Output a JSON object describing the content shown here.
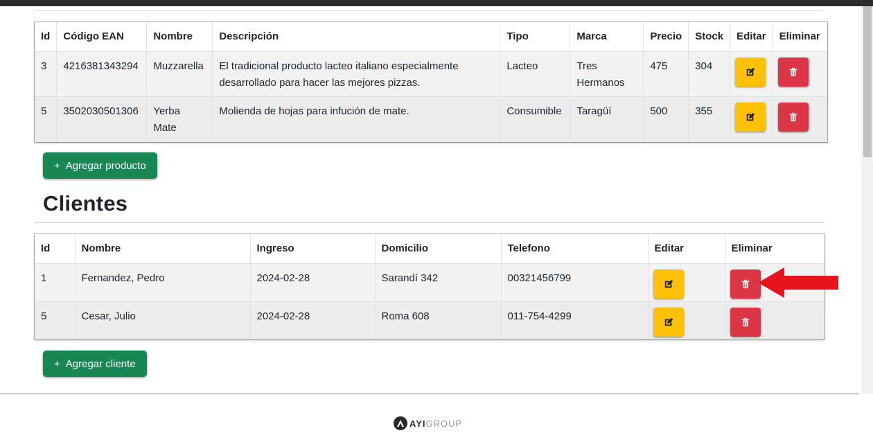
{
  "productos": {
    "headers": [
      "Id",
      "Código EAN",
      "Nombre",
      "Descripción",
      "Tipo",
      "Marca",
      "Precio",
      "Stock",
      "Editar",
      "Eliminar"
    ],
    "rows": [
      {
        "id": "3",
        "ean": "4216381343294",
        "nombre": "Muzzarella",
        "descripcion": "El tradicional producto lacteo italiano especialmente desarrollado para hacer las mejores pizzas.",
        "tipo": "Lacteo",
        "marca": "Tres Hermanos",
        "precio": "475",
        "stock": "304"
      },
      {
        "id": "5",
        "ean": "3502030501306",
        "nombre": "Yerba Mate",
        "descripcion": "Molienda de hojas para infución de mate.",
        "tipo": "Consumible",
        "marca": "Taragüí",
        "precio": "500",
        "stock": "355"
      }
    ],
    "add_label": "Agregar producto"
  },
  "clientes": {
    "title": "Clientes",
    "headers": [
      "Id",
      "Nombre",
      "Ingreso",
      "Domicilio",
      "Telefono",
      "Editar",
      "Eliminar"
    ],
    "rows": [
      {
        "id": "1",
        "nombre": "Fernandez, Pedro",
        "ingreso": "2024-02-28",
        "domicilio": "Sarandí 342",
        "telefono": "00321456799"
      },
      {
        "id": "5",
        "nombre": "Cesar, Julio",
        "ingreso": "2024-02-28",
        "domicilio": "Roma 608",
        "telefono": "011-754-4299"
      }
    ],
    "add_label": "Agregar cliente"
  },
  "add_prefix": "+",
  "footer": {
    "logo_main": "AYI",
    "logo_sub": "GROUP"
  },
  "icons": {
    "edit": "pencil-square-icon",
    "delete": "trash-icon",
    "annotation": "red-arrow-icon"
  },
  "colors": {
    "edit": "#ffc107",
    "delete": "#dc3545",
    "add": "#198754",
    "arrow": "#e8141c"
  }
}
